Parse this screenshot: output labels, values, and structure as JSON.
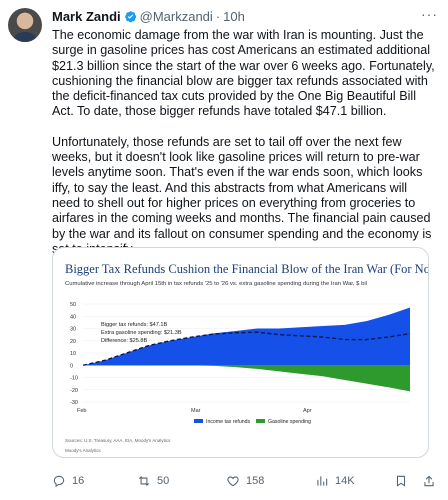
{
  "tweet": {
    "author_name": "Mark Zandi",
    "handle": "@Markzandi",
    "separator": "·",
    "time": "10h",
    "paragraphs": [
      "The economic damage from the war with Iran is mounting. Just the surge in gasoline prices has cost Americans an estimated additional $21.3 billion since the start of the war over 6 weeks ago. Fortunately, cushioning the financial blow are bigger tax refunds associated with the deficit-financed tax cuts provided by the One Big Beautiful Bill Act. To date, those bigger refunds have totaled $47.1 billion.",
      "Unfortunately, those refunds are set to tail off over the next few weeks, but it doesn't look like gasoline prices will return to pre-war levels anytime soon. That's even if the war ends soon, which looks iffy, to say the least. And this abstracts from what Americans will need to shell out for higher prices on everything from groceries to airfares in the coming weeks and months.  The financial pain caused by the war and its fallout on consumer spending and the economy is set to intensify."
    ]
  },
  "actions": {
    "replies": "16",
    "reposts": "50",
    "likes": "158",
    "views": "14K"
  },
  "colors": {
    "tax_refunds": "#1550e8",
    "gasoline": "#2e9a2e",
    "difference": "#0a1a4a",
    "title": "#1c3f7a"
  },
  "chart_data": {
    "type": "area",
    "title": "Bigger Tax Refunds Cushion the Financial Blow of the Iran War (For Now)",
    "subtitle": "Cumulative increase through April 15th in tax refunds '25 to '26 vs. extra gasoline spending during the Iran War, $ bil",
    "annotations": [
      "Bigger tax refunds: $47.1B",
      "Extra gasoline spending: $21.3B",
      "Difference: $25.8B"
    ],
    "ylim": [
      -30,
      50
    ],
    "y_ticks": [
      "50",
      "40",
      "30",
      "20",
      "10",
      "0",
      "-10",
      "-20",
      "-30"
    ],
    "x_ticks": [
      "Feb",
      "Mar",
      "Apr"
    ],
    "x": [
      0,
      5,
      10,
      15,
      20,
      25,
      30,
      35,
      40,
      45,
      50,
      55,
      60,
      65,
      70,
      75
    ],
    "series": [
      {
        "name": "Income tax refunds",
        "kind": "area",
        "values": [
          0,
          4,
          10,
          16,
          20,
          23,
          26,
          28,
          30,
          30,
          31,
          32,
          33,
          36,
          41,
          47.1
        ]
      },
      {
        "name": "Gasoline spending",
        "kind": "area",
        "values": [
          0,
          0,
          0,
          0,
          0,
          0,
          -0.5,
          -1.5,
          -3,
          -5,
          -7,
          -9,
          -12,
          -15,
          -18,
          -21.3
        ]
      },
      {
        "name": "Difference",
        "kind": "dashed-line",
        "values": [
          0,
          4,
          10,
          16,
          20,
          23,
          25.5,
          26.5,
          27,
          25,
          24,
          23,
          21,
          21,
          23,
          25.8
        ]
      }
    ],
    "legend": [
      "Income tax refunds",
      "Gasoline spending"
    ],
    "sources": "Sources: U.S. Treasury, AAA, EIA, Moody's Analytics",
    "credit": "Moody's Analytics"
  }
}
